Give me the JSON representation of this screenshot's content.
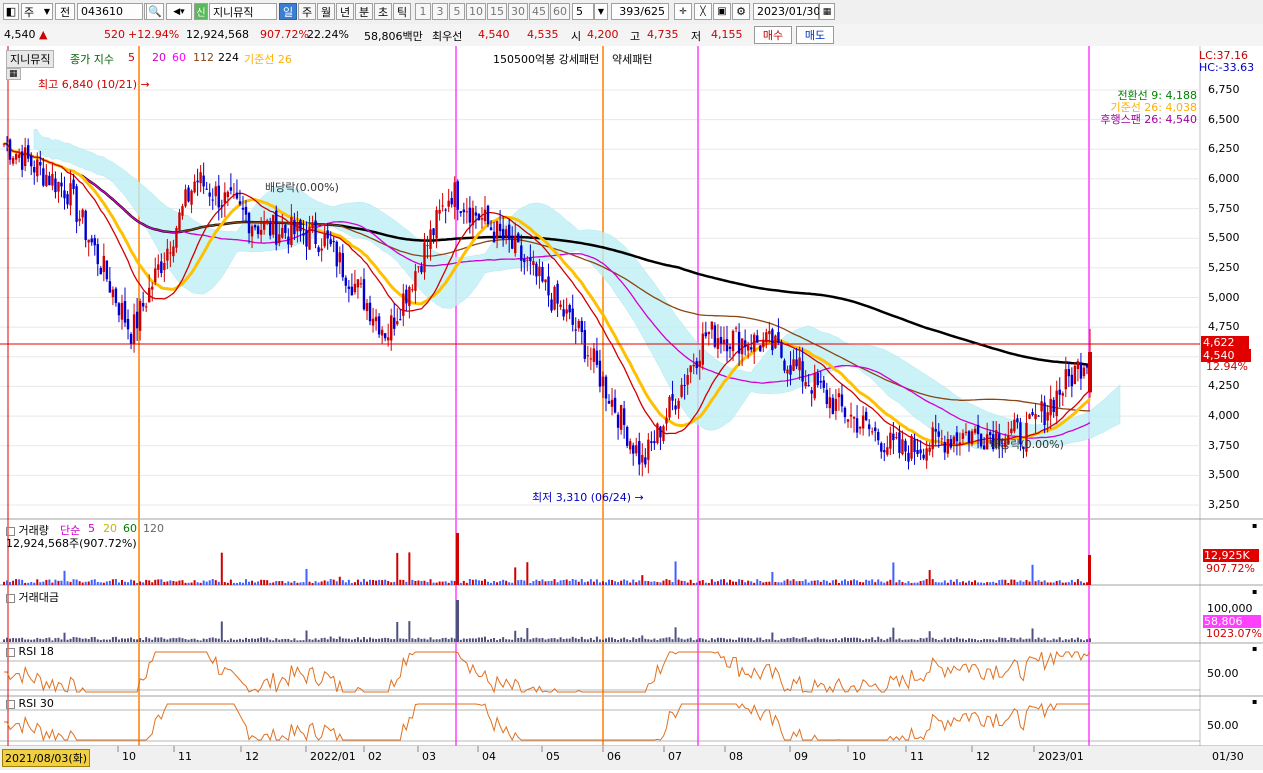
{
  "toolbar": {
    "type_select": "주",
    "prev_label": "전",
    "code": "043610",
    "stock_name": "지니뮤직",
    "credit_badge": "신",
    "periods": [
      "일",
      "주",
      "월",
      "년",
      "분",
      "초",
      "틱"
    ],
    "selected_period": "일",
    "tick_buttons": [
      "1",
      "3",
      "5",
      "10",
      "15",
      "30",
      "45",
      "60"
    ],
    "interval_value": "5",
    "page_position": "393/625",
    "date_value": "2023/01/30"
  },
  "quote": {
    "price": "4,540",
    "change": "520",
    "change_pct": "+12.94%",
    "volume": "12,924,568",
    "volume_pct": "907.72%",
    "turnover_pct": "22.24%",
    "amount": "58,806백만",
    "prior_label": "최우선",
    "ask": "4,540",
    "bid": "4,535",
    "open_label": "시",
    "open": "4,200",
    "high_label": "고",
    "high": "4,735",
    "low_label": "저",
    "low": "4,155",
    "buy_label": "매수",
    "sell_label": "매도"
  },
  "legend": {
    "stock_tab": "지니뮤직",
    "ma_label": "종가 지수",
    "ma_periods": [
      "5",
      "20",
      "60",
      "112",
      "224"
    ],
    "ma_colors": [
      "#d00000",
      "#d000d0",
      "#ff00ff",
      "#8b4513",
      "#000000"
    ],
    "kijun_label": "기준선 26",
    "pattern_label": "150500억봉 강세패턴",
    "weak_label": "약세패턴"
  },
  "ichimoku_labels": {
    "tenkan": "전환선 9: 4,188",
    "kijun": "기준선 26: 4,038",
    "chikou": "후행스팬 26: 4,540"
  },
  "top_right": {
    "lc": "LC:37.16",
    "hc": "HC:-33.63"
  },
  "annotations": {
    "high": "최고 6,840 (10/21)",
    "low": "최저 3,310 (06/24)",
    "dividend1": "배당락(0.00%)",
    "dividend2": "배당락(0.00%)"
  },
  "price_axis": [
    "6,750",
    "6,500",
    "6,250",
    "6,000",
    "5,750",
    "5,500",
    "5,250",
    "5,000",
    "4,750",
    "4,500",
    "4,250",
    "4,000",
    "3,750",
    "3,500",
    "3,250"
  ],
  "price_badges": {
    "cross_price": "4,622",
    "current_price": "4,540",
    "current_pct": "12.94%"
  },
  "volume_panel": {
    "title": "거래량",
    "ma_label": "단순",
    "ma_periods": [
      "5",
      "20",
      "60",
      "120"
    ],
    "value_label": "12,924,568주(907.72%)",
    "badge_value": "12,925K",
    "badge_pct": "907.72%"
  },
  "amount_panel": {
    "title": "거래대금",
    "axis": "100,000",
    "badge_value": "58,806",
    "badge_pct": "1023.07%"
  },
  "rsi18_panel": {
    "title": "RSI 18",
    "axis": "50.00"
  },
  "rsi30_panel": {
    "title": "RSI 30",
    "axis": "50.00"
  },
  "x_axis": {
    "start_date": "2021/08/03(화)",
    "labels": [
      "10",
      "11",
      "12",
      "2022/01",
      "02",
      "03",
      "04",
      "05",
      "06",
      "07",
      "08",
      "09",
      "10",
      "11",
      "12",
      "2023/01"
    ],
    "end_label": "01/30"
  },
  "chart_data": {
    "type": "candlestick",
    "price_range": [
      3200,
      6850
    ],
    "close_series_monthly": [
      {
        "month": "2021-08",
        "close": 6300
      },
      {
        "month": "2021-09",
        "close": 5900
      },
      {
        "month": "2021-10",
        "close": 4700
      },
      {
        "month": "2021-11",
        "close": 6000
      },
      {
        "month": "2021-12",
        "close": 5600
      },
      {
        "month": "2022-01",
        "close": 5500
      },
      {
        "month": "2022-02",
        "close": 4700
      },
      {
        "month": "2022-03",
        "close": 5900
      },
      {
        "month": "2022-04",
        "close": 5400
      },
      {
        "month": "2022-05",
        "close": 4700
      },
      {
        "month": "2022-06",
        "close": 3600
      },
      {
        "month": "2022-07",
        "close": 4700
      },
      {
        "month": "2022-08",
        "close": 4600
      },
      {
        "month": "2022-09",
        "close": 4100
      },
      {
        "month": "2022-10",
        "close": 3700
      },
      {
        "month": "2022-11",
        "close": 3850
      },
      {
        "month": "2022-12",
        "close": 3850
      },
      {
        "month": "2023-01",
        "close": 4540
      }
    ],
    "high": {
      "value": 6840,
      "date": "10/21"
    },
    "low": {
      "value": 3310,
      "date": "06/24"
    }
  },
  "colors": {
    "up": "#d00000",
    "down": "#0000d0",
    "ma5": "#d00000",
    "ma20": "#d000d0",
    "ma60": "#8b4513",
    "ma224": "#000000",
    "kijun": "#ffc000",
    "cloud": "#bff0f5",
    "vertical_pink": "#ff70ff",
    "vertical_orange": "#ffa040"
  }
}
